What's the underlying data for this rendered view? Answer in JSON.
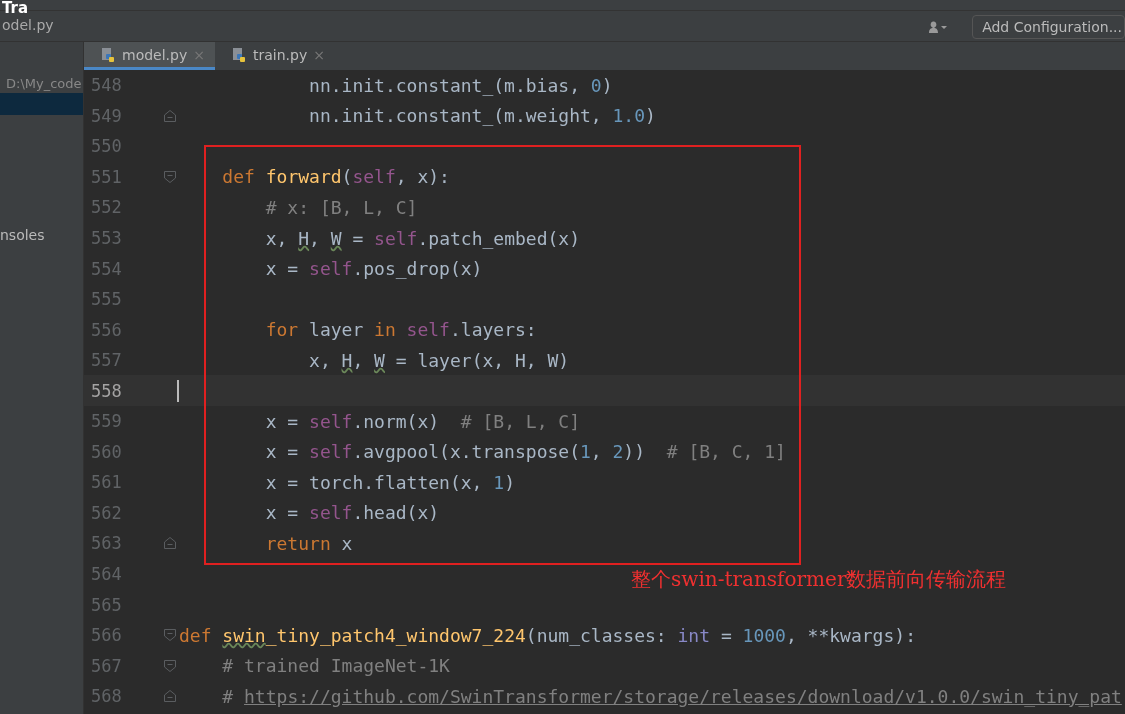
{
  "sidebar": {
    "title": "Tra",
    "file": "odel.py",
    "path": "D:\\My_code",
    "items": [
      {
        "label": "nsoles",
        "selected": false
      }
    ]
  },
  "toolbar": {
    "configuration_button": "Add Configuration..."
  },
  "tabs": [
    {
      "label": "model.py",
      "selected": true,
      "close": "×"
    },
    {
      "label": "train.py",
      "selected": false,
      "close": "×"
    }
  ],
  "editor": {
    "lines": [
      {
        "number": "548",
        "current": false,
        "tokens": [
          {
            "kind": "plain",
            "text": "            nn.init.constant_(m.bias, "
          },
          {
            "kind": "num",
            "text": "0"
          },
          {
            "kind": "plain",
            "text": ")"
          }
        ]
      },
      {
        "number": "549",
        "current": false,
        "fold_end": true,
        "tokens": [
          {
            "kind": "plain",
            "text": "            nn.init.constant_(m.weight, "
          },
          {
            "kind": "num",
            "text": "1.0"
          },
          {
            "kind": "plain",
            "text": ")"
          }
        ]
      },
      {
        "number": "550",
        "current": false
      },
      {
        "number": "551",
        "current": false,
        "fold_start": true,
        "tokens": [
          {
            "kind": "kw",
            "text": "    def "
          },
          {
            "kind": "fn",
            "text": "forward"
          },
          {
            "kind": "plain",
            "text": "("
          },
          {
            "kind": "self",
            "text": "self"
          },
          {
            "kind": "plain",
            "text": ", x):"
          }
        ]
      },
      {
        "number": "552",
        "current": false,
        "tokens": [
          {
            "kind": "cmt",
            "text": "        # x: [B, L, C]"
          }
        ]
      },
      {
        "number": "553",
        "current": false,
        "tokens": [
          {
            "kind": "plain",
            "text": "        x, "
          },
          {
            "kind": "warn",
            "text": "H"
          },
          {
            "kind": "plain",
            "text": ", "
          },
          {
            "kind": "warn",
            "text": "W"
          },
          {
            "kind": "plain",
            "text": " = "
          },
          {
            "kind": "self",
            "text": "self"
          },
          {
            "kind": "plain",
            "text": ".patch_embed(x)"
          }
        ]
      },
      {
        "number": "554",
        "current": false,
        "tokens": [
          {
            "kind": "plain",
            "text": "        x = "
          },
          {
            "kind": "self",
            "text": "self"
          },
          {
            "kind": "plain",
            "text": ".pos_drop(x)"
          }
        ]
      },
      {
        "number": "555",
        "current": false
      },
      {
        "number": "556",
        "current": false,
        "tokens": [
          {
            "kind": "kw",
            "text": "        for "
          },
          {
            "kind": "plain",
            "text": "layer "
          },
          {
            "kind": "kw",
            "text": "in "
          },
          {
            "kind": "self",
            "text": "self"
          },
          {
            "kind": "plain",
            "text": ".layers:"
          }
        ]
      },
      {
        "number": "557",
        "current": false,
        "tokens": [
          {
            "kind": "plain",
            "text": "            x, "
          },
          {
            "kind": "warn",
            "text": "H"
          },
          {
            "kind": "plain",
            "text": ", "
          },
          {
            "kind": "warn",
            "text": "W"
          },
          {
            "kind": "plain",
            "text": " = layer(x, H, W)"
          }
        ]
      },
      {
        "number": "558",
        "current": true
      },
      {
        "number": "559",
        "current": false,
        "tokens": [
          {
            "kind": "plain",
            "text": "        x = "
          },
          {
            "kind": "self",
            "text": "self"
          },
          {
            "kind": "plain",
            "text": ".norm(x)  "
          },
          {
            "kind": "cmt",
            "text": "# [B, L, C]"
          }
        ]
      },
      {
        "number": "560",
        "current": false,
        "tokens": [
          {
            "kind": "plain",
            "text": "        x = "
          },
          {
            "kind": "self",
            "text": "self"
          },
          {
            "kind": "plain",
            "text": ".avgpool(x.transpose("
          },
          {
            "kind": "num",
            "text": "1"
          },
          {
            "kind": "plain",
            "text": ", "
          },
          {
            "kind": "num",
            "text": "2"
          },
          {
            "kind": "plain",
            "text": "))  "
          },
          {
            "kind": "cmt",
            "text": "# [B, C, 1]"
          }
        ]
      },
      {
        "number": "561",
        "current": false,
        "tokens": [
          {
            "kind": "plain",
            "text": "        x = torch.flatten(x, "
          },
          {
            "kind": "num",
            "text": "1"
          },
          {
            "kind": "plain",
            "text": ")"
          }
        ]
      },
      {
        "number": "562",
        "current": false,
        "tokens": [
          {
            "kind": "plain",
            "text": "        x = "
          },
          {
            "kind": "self",
            "text": "self"
          },
          {
            "kind": "plain",
            "text": ".head(x)"
          }
        ]
      },
      {
        "number": "563",
        "current": false,
        "fold_end": true,
        "tokens": [
          {
            "kind": "kw",
            "text": "        return "
          },
          {
            "kind": "plain",
            "text": "x"
          }
        ]
      },
      {
        "number": "564",
        "current": false
      },
      {
        "number": "565",
        "current": false
      },
      {
        "number": "566",
        "current": false,
        "fold_start": true,
        "tokens": [
          {
            "kind": "kw",
            "text": "def "
          },
          {
            "kind": "fnwarn",
            "text": "swin"
          },
          {
            "kind": "fn",
            "text": "_tiny_patch4_window7_224"
          },
          {
            "kind": "plain",
            "text": "(num_classes: "
          },
          {
            "kind": "builtin",
            "text": "int"
          },
          {
            "kind": "plain",
            "text": " = "
          },
          {
            "kind": "num",
            "text": "1000"
          },
          {
            "kind": "plain",
            "text": ", **kwargs):"
          }
        ]
      },
      {
        "number": "567",
        "current": false,
        "fold_start": true,
        "tokens": [
          {
            "kind": "cmt",
            "text": "    # trained ImageNet-1K"
          }
        ]
      },
      {
        "number": "568",
        "current": false,
        "fold_end": true,
        "tokens": [
          {
            "kind": "cmt",
            "text": "    # "
          },
          {
            "kind": "link",
            "text": "https://github.com/SwinTransformer/storage/releases/download/v1.0.0/swin_tiny_pat"
          }
        ]
      }
    ]
  },
  "annotation": {
    "caption": "整个swin-transformer数据前向传输流程"
  }
}
